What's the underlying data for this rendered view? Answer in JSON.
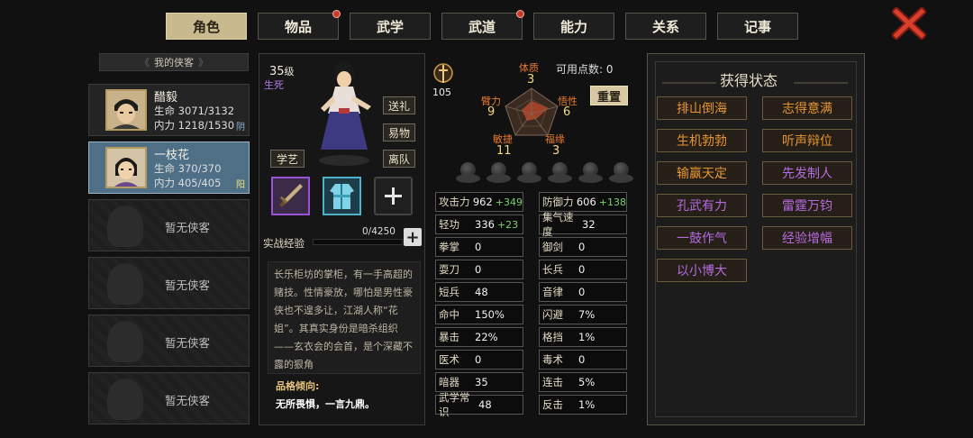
{
  "tabs": [
    {
      "label": "角色",
      "active": true,
      "badge": false
    },
    {
      "label": "物品",
      "active": false,
      "badge": true
    },
    {
      "label": "武学",
      "active": false,
      "badge": false
    },
    {
      "label": "武道",
      "active": false,
      "badge": true
    },
    {
      "label": "能力",
      "active": false,
      "badge": false
    },
    {
      "label": "关系",
      "active": false,
      "badge": false
    },
    {
      "label": "记事",
      "active": false,
      "badge": false
    }
  ],
  "close_icon": "close-x-icon",
  "sidebar": {
    "header": "我的侠客",
    "characters": [
      {
        "name": "醋毅",
        "hp": "生命 3071/3132",
        "mp": "内力 1218/1530",
        "yy": "阴",
        "active": false
      },
      {
        "name": "一枝花",
        "hp": "生命 370/370",
        "mp": "内力 405/405",
        "yy": "阳",
        "active": true
      }
    ],
    "empty_label": "暂无侠客",
    "empty_count": 4
  },
  "profile": {
    "level": "35",
    "level_suffix": "级",
    "status": "生死",
    "buttons": {
      "gift": "送礼",
      "change": "易物",
      "leave": "离队",
      "learn": "学艺"
    },
    "exp_label": "实战经验",
    "exp_value": "0/4250",
    "exp_fraction": 0.0,
    "bio": "长乐柜坊的掌柜，有一手高超的赌技。性情豪放，哪怕是男性豪侠也不遑多让，江湖人称“花姐”。其真实身份是暗杀组织——玄衣会的会首，是个深藏不露的狠角",
    "personality_label": "品格倾向:",
    "personality_value": "无所畏惧，一言九鼎。"
  },
  "attributes": {
    "top_value": "105",
    "points_label": "可用点数: 0",
    "reset_label": "重置",
    "pentagon": [
      {
        "label": "体质",
        "value": "3"
      },
      {
        "label": "悟性",
        "value": "6"
      },
      {
        "label": "福缘",
        "value": "3"
      },
      {
        "label": "敏捷",
        "value": "11"
      },
      {
        "label": "臂力",
        "value": "9"
      }
    ],
    "stats": [
      [
        {
          "k": "攻击力",
          "v": "962",
          "g": "+349"
        },
        {
          "k": "防御力",
          "v": "606",
          "g": "+138"
        }
      ],
      [
        {
          "k": "轻功",
          "v": "336",
          "g": "+23"
        },
        {
          "k": "集气速度",
          "v": "32",
          "g": ""
        }
      ],
      [
        {
          "k": "拳掌",
          "v": "0",
          "g": ""
        },
        {
          "k": "御剑",
          "v": "0",
          "g": ""
        }
      ],
      [
        {
          "k": "耍刀",
          "v": "0",
          "g": ""
        },
        {
          "k": "长兵",
          "v": "0",
          "g": ""
        }
      ],
      [
        {
          "k": "短兵",
          "v": "48",
          "g": ""
        },
        {
          "k": "音律",
          "v": "0",
          "g": ""
        }
      ],
      [
        {
          "k": "命中",
          "v": "150%",
          "g": ""
        },
        {
          "k": "闪避",
          "v": "7%",
          "g": ""
        }
      ],
      [
        {
          "k": "暴击",
          "v": "22%",
          "g": ""
        },
        {
          "k": "格挡",
          "v": "1%",
          "g": ""
        }
      ],
      [
        {
          "k": "医术",
          "v": "0",
          "g": ""
        },
        {
          "k": "毒术",
          "v": "0",
          "g": ""
        }
      ],
      [
        {
          "k": "暗器",
          "v": "35",
          "g": ""
        },
        {
          "k": "连击",
          "v": "5%",
          "g": ""
        }
      ],
      [
        {
          "k": "武学常识",
          "v": "48",
          "g": ""
        },
        {
          "k": "反击",
          "v": "1%",
          "g": ""
        }
      ]
    ]
  },
  "states": {
    "title": "获得状态",
    "items": [
      {
        "label": "排山倒海",
        "color": "orange"
      },
      {
        "label": "志得意满",
        "color": "orange"
      },
      {
        "label": "生机勃勃",
        "color": "orange"
      },
      {
        "label": "听声辩位",
        "color": "orange"
      },
      {
        "label": "输赢天定",
        "color": "orange"
      },
      {
        "label": "先发制人",
        "color": "purple"
      },
      {
        "label": "孔武有力",
        "color": "purple"
      },
      {
        "label": "雷霆万钧",
        "color": "purple"
      },
      {
        "label": "一鼓作气",
        "color": "purple"
      },
      {
        "label": "经验增幅",
        "color": "purple"
      },
      {
        "label": "以小博大",
        "color": "purple"
      }
    ]
  }
}
